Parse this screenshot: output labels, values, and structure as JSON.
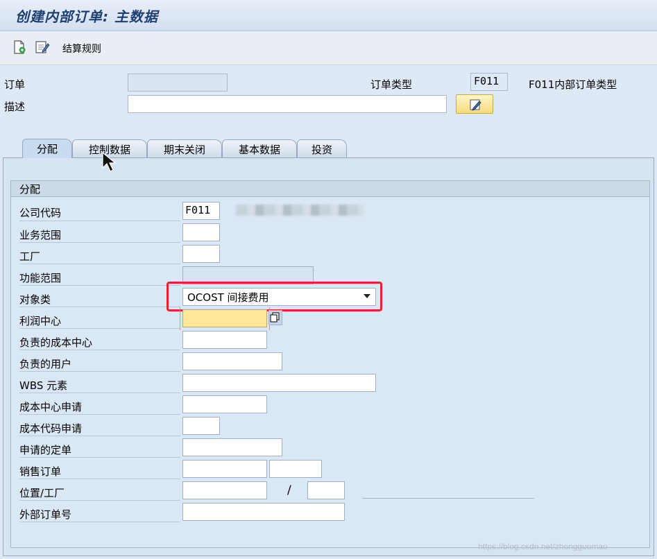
{
  "window": {
    "title": "创建内部订单: 主数据"
  },
  "toolbar": {
    "settlement_rule_label": "结算规则",
    "icons": [
      "new-document-icon",
      "edit-document-icon"
    ]
  },
  "header": {
    "order_label": "订单",
    "order_value": "",
    "description_label": "描述",
    "description_value": "",
    "order_type_label": "订单类型",
    "order_type_value": "F011",
    "order_type_text": "F011内部订单类型"
  },
  "tabs": [
    {
      "label": "分配",
      "active": true
    },
    {
      "label": "控制数据",
      "active": false
    },
    {
      "label": "期末关闭",
      "active": false
    },
    {
      "label": "基本数据",
      "active": false
    },
    {
      "label": "投资",
      "active": false
    }
  ],
  "assignment": {
    "group_title": "分配",
    "company_code_label": "公司代码",
    "company_code_value": "F011",
    "business_area_label": "业务范围",
    "plant_label": "工厂",
    "functional_area_label": "功能范围",
    "object_class_label": "对象类",
    "object_class_value": "OCOST 间接费用",
    "profit_center_label": "利润中心",
    "responsible_cost_center_label": "负责的成本中心",
    "responsible_user_label": "负责的用户",
    "wbs_element_label": "WBS 元素",
    "requesting_cost_center_label": "成本中心申请",
    "requesting_company_code_label": "成本代码申请",
    "requesting_order_label": "申请的定单",
    "sales_order_label": "销售订单",
    "location_plant_label": "位置/工厂",
    "location_separator": "/",
    "external_order_label": "外部订单号"
  },
  "watermark": "https://blog.csdn.net/zhongguomao",
  "colors": {
    "background": "#dfe9f5",
    "title_text": "#1f3f73",
    "required_field": "#fde79b",
    "highlight_red": "#e8232b"
  }
}
